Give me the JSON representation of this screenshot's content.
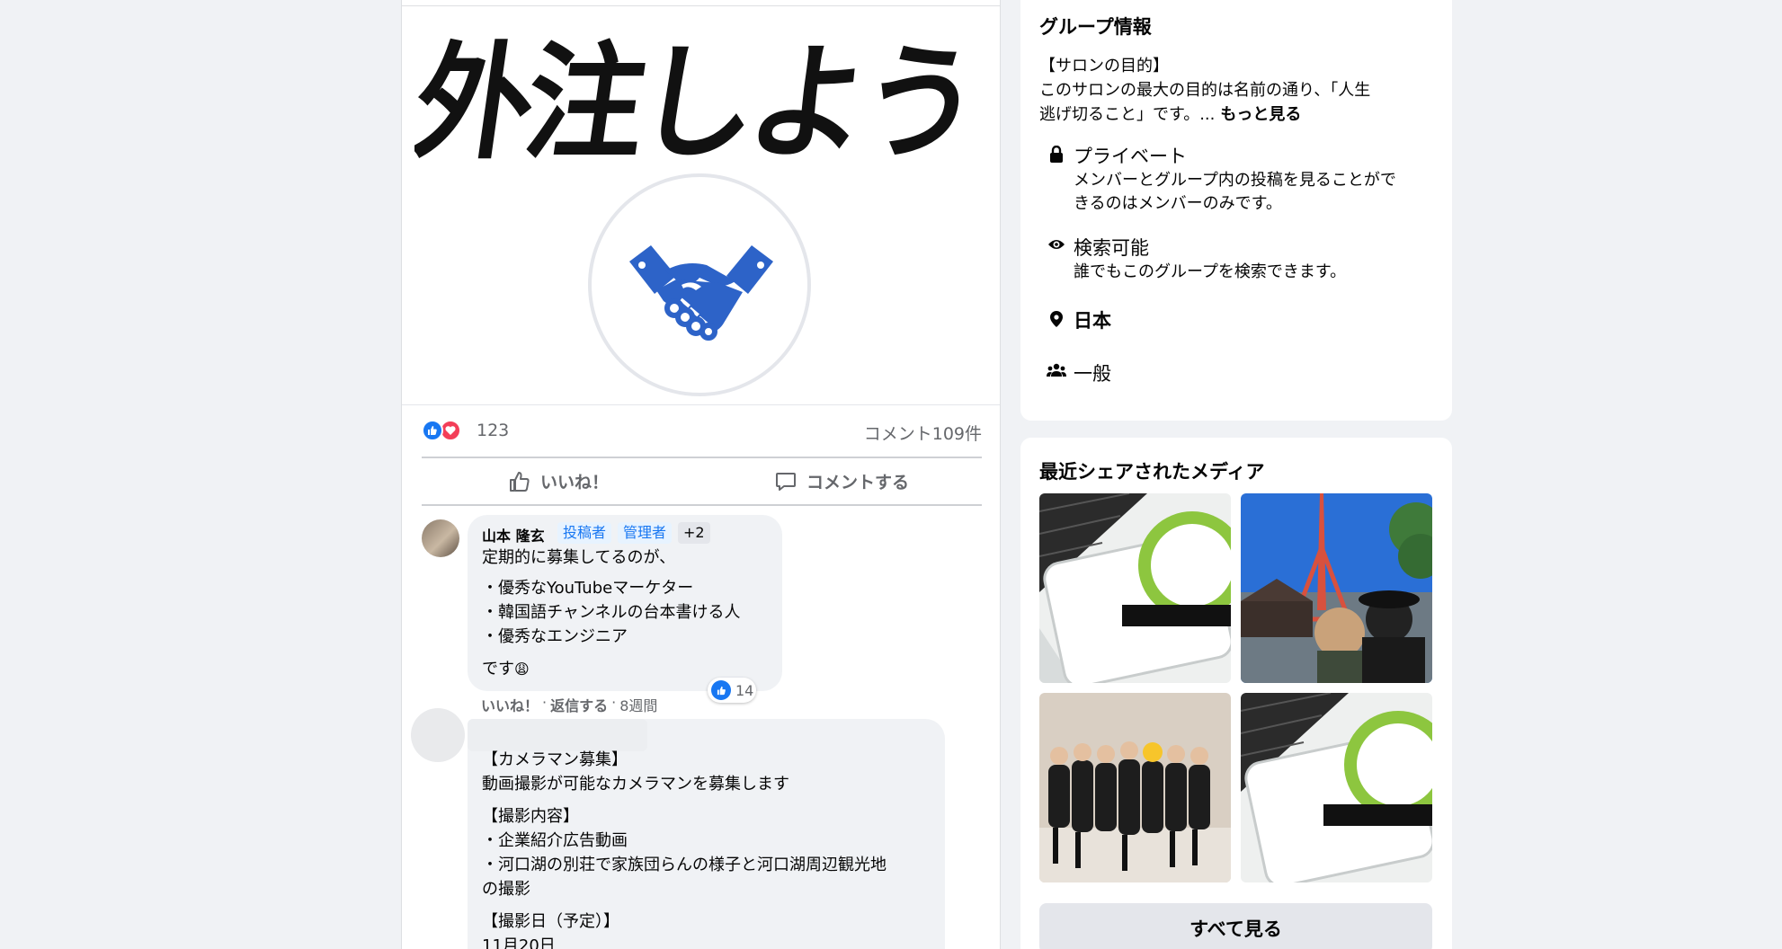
{
  "post": {
    "image_title": "外注しよう",
    "reaction_count": "123",
    "comment_count": "コメント109件",
    "like_action": "いいね！",
    "comment_action": "コメントする"
  },
  "comments": [
    {
      "author": "山本 隆玄",
      "badges": [
        "投稿者",
        "管理者",
        "+2"
      ],
      "lines": [
        "定期的に募集してるのが、",
        "・優秀なYouTubeマーケター",
        "・韓国語チャンネルの台本書ける人",
        "・優秀なエンジニア",
        "です"
      ],
      "emoji": "😩",
      "like_count": "14",
      "meta": {
        "like": "いいね！",
        "reply": "返信する",
        "time": "8週間"
      }
    },
    {
      "lines": [
        "【カメラマン募集】",
        "動画撮影が可能なカメラマンを募集します",
        "【撮影内容】",
        "・企業紹介広告動画",
        "・河口湖の別荘で家族団らんの様子と河口湖周辺観光地",
        "の撮影",
        "【撮影日（予定）】",
        "11月20日"
      ]
    }
  ],
  "group_info": {
    "title": "グループ情報",
    "desc_line1": "【サロンの目的】",
    "desc_line2": "このサロンの最大の目的は名前の通り、「人生",
    "desc_line3": "逃げ切ること」です。...",
    "see_more": "もっと見る",
    "privacy_title": "プライベート",
    "privacy_desc1": "メンバーとグループ内の投稿を見ることがで",
    "privacy_desc2": "きるのはメンバーのみです。",
    "visibility_title": "検索可能",
    "visibility_desc": "誰でもこのグループを検索できます。",
    "location": "日本",
    "category": "一般",
    "icons": [
      "lock-icon",
      "eye-icon",
      "location-pin-icon",
      "people-icon"
    ]
  },
  "media": {
    "title": "最近シェアされたメディア",
    "see_all": "すべて見る"
  },
  "colors": {
    "accent": "#1877f2",
    "love": "#f33e58",
    "logo_blue": "#2d63c8"
  }
}
